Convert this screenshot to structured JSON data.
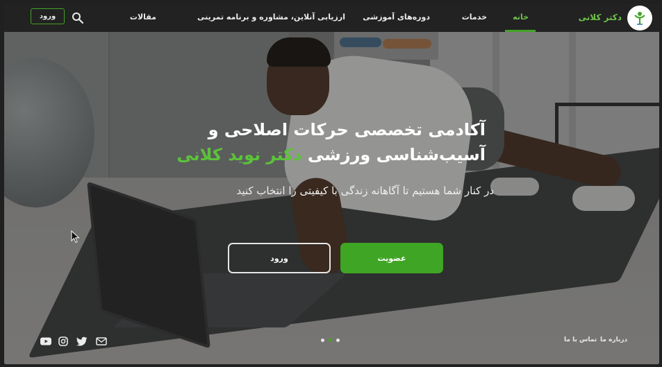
{
  "navbar": {
    "brand": "دکتر کلانی",
    "items": [
      {
        "label": "خانه",
        "active": true
      },
      {
        "label": "خدمات",
        "active": false
      },
      {
        "label": "دوره‌های آموزشی",
        "active": false
      },
      {
        "label": "ارزیابی آنلاین، مشاوره و برنامه تمرینی",
        "active": false
      },
      {
        "label": "مقالات",
        "active": false
      }
    ],
    "login_label": "ورود",
    "search_icon": "search-icon"
  },
  "hero": {
    "headline_line1": "آکادمی تخصصی حرکات اصلاحی و",
    "headline_line2_prefix": "آسیب‌شناسی ورزشی",
    "headline_line2_accent": "دکتر نوید کلانی",
    "subline": "در کنار شما هستیم تا آگاهانه زندگی با کیفیتی را انتخاب کنید",
    "join_button": "عضویت",
    "login_button": "ورود"
  },
  "footer": {
    "links": [
      "درباره ما",
      "تماس با ما"
    ],
    "social_icons": [
      "mail-icon",
      "twitter-icon",
      "instagram-icon",
      "youtube-icon"
    ],
    "slider_dots": 3,
    "active_dot": 1
  },
  "colors": {
    "accent_green": "#3fa524",
    "brand_green": "#6fc24a",
    "navbar_bg": "#222222"
  }
}
